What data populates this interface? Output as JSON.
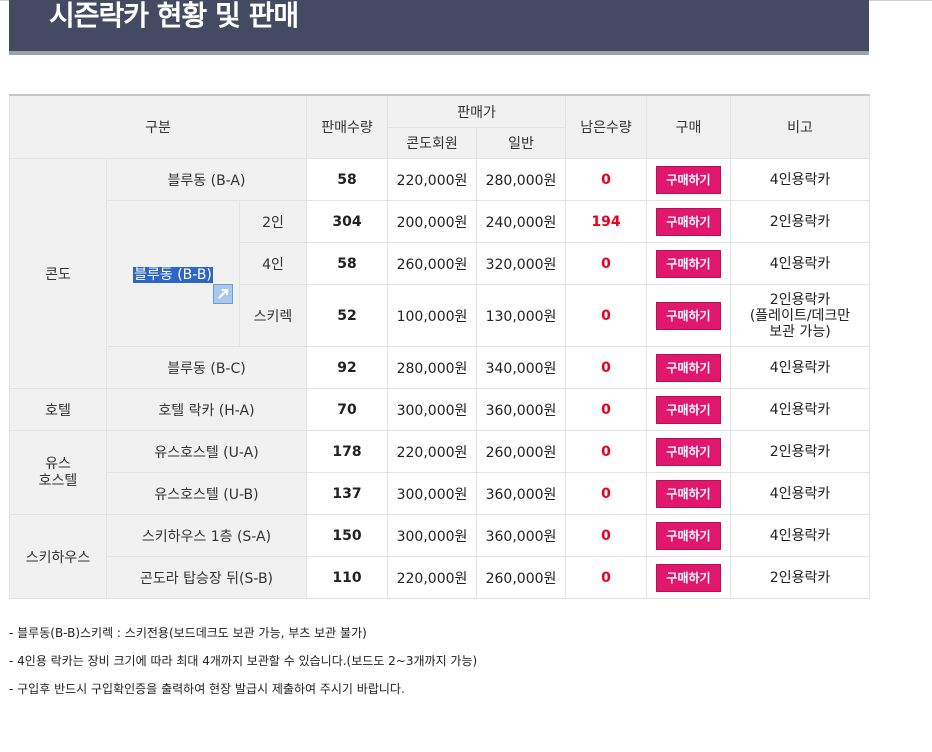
{
  "title": "시즌락카 현황 및 판매",
  "headers": {
    "category": "구분",
    "sold_qty": "판매수량",
    "price": "판매가",
    "condo_member": "콘도회원",
    "general": "일반",
    "remaining": "남은수량",
    "buy": "구매",
    "note": "비고"
  },
  "buy_label": "구매하기",
  "groups": {
    "condo": "콘도",
    "hotel": "호텔",
    "youth_hostel": "유스\n호스텔",
    "ski_house": "스키하우스"
  },
  "rows": [
    {
      "name": "블루동 (B-A)",
      "qty": "58",
      "condo_price": "220,000원",
      "general_price": "280,000원",
      "remaining": "0",
      "note": "4인용락카"
    },
    {
      "sub": "2인",
      "qty": "304",
      "condo_price": "200,000원",
      "general_price": "240,000원",
      "remaining": "194",
      "note": "2인용락카"
    },
    {
      "sub": "4인",
      "qty": "58",
      "condo_price": "260,000원",
      "general_price": "320,000원",
      "remaining": "0",
      "note": "4인용락카"
    },
    {
      "sub": "스키렉",
      "qty": "52",
      "condo_price": "100,000원",
      "general_price": "130,000원",
      "remaining": "0",
      "note": "2인용락카\n(플레이트/데크만\n보관 가능)"
    },
    {
      "name": "블루동 (B-C)",
      "qty": "92",
      "condo_price": "280,000원",
      "general_price": "340,000원",
      "remaining": "0",
      "note": "4인용락카"
    },
    {
      "name": "호텔 락카 (H-A)",
      "qty": "70",
      "condo_price": "300,000원",
      "general_price": "360,000원",
      "remaining": "0",
      "note": "4인용락카"
    },
    {
      "name": "유스호스텔 (U-A)",
      "qty": "178",
      "condo_price": "220,000원",
      "general_price": "260,000원",
      "remaining": "0",
      "note": "2인용락카"
    },
    {
      "name": "유스호스텔 (U-B)",
      "qty": "137",
      "condo_price": "300,000원",
      "general_price": "360,000원",
      "remaining": "0",
      "note": "4인용락카"
    },
    {
      "name": "스키하우스 1층 (S-A)",
      "qty": "150",
      "condo_price": "300,000원",
      "general_price": "360,000원",
      "remaining": "0",
      "note": "4인용락카"
    },
    {
      "name": "곤도라 탑승장 뒤(S-B)",
      "qty": "110",
      "condo_price": "220,000원",
      "general_price": "260,000원",
      "remaining": "0",
      "note": "2인용락카"
    }
  ],
  "bb_name": "블루동 (B-B)",
  "notes": [
    "- 블루동(B-B)스키렉 : 스키전용(보드데크도 보관 가능, 부츠 보관 불가)",
    "- 4인용 락카는 장비 크기에 따라 최대 4개까지 보관할 수 있습니다.(보드도 2~3개까지 가능)",
    "- 구입후 반드시 구입확인증을 출력하여 현장 발급시 제출하여 주시기 바랍니다."
  ]
}
